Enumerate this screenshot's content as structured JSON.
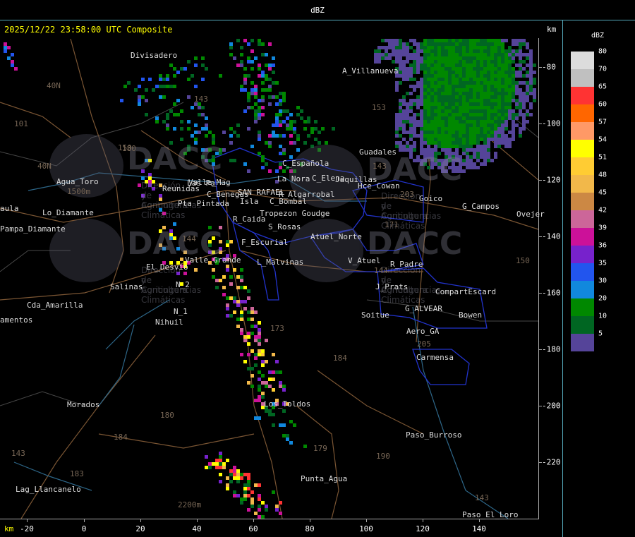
{
  "header": {
    "title": "dBZ"
  },
  "timestamp": "2025/12/22 23:58:00 UTC Composite",
  "units": {
    "km_top": "km",
    "km_bottom": "km"
  },
  "x_ticks": [
    "-20",
    "0",
    "20",
    "40",
    "60",
    "80",
    "100",
    "120",
    "140"
  ],
  "y_ticks": [
    "-80",
    "-100",
    "-120",
    "-140",
    "-160",
    "-180",
    "-200",
    "-220"
  ],
  "legend": {
    "title": "dBZ",
    "items": [
      {
        "label": "80",
        "color": "#dcdcdc"
      },
      {
        "label": "70",
        "color": "#c0c0c0"
      },
      {
        "label": "65",
        "color": "#ff3333"
      },
      {
        "label": "60",
        "color": "#ff6600"
      },
      {
        "label": "57",
        "color": "#ff9966"
      },
      {
        "label": "54",
        "color": "#ffff00"
      },
      {
        "label": "51",
        "color": "#ffcc33"
      },
      {
        "label": "48",
        "color": "#f2b84a"
      },
      {
        "label": "45",
        "color": "#cc8844"
      },
      {
        "label": "42",
        "color": "#cc6699"
      },
      {
        "label": "39",
        "color": "#cc1199"
      },
      {
        "label": "36",
        "color": "#7722cc"
      },
      {
        "label": "35",
        "color": "#2255ee"
      },
      {
        "label": "30",
        "color": "#1188dd"
      },
      {
        "label": "20",
        "color": "#008800"
      },
      {
        "label": "10",
        "color": "#006622"
      },
      {
        "label": "5",
        "color": "#554499"
      }
    ]
  },
  "towns": [
    {
      "name": "Divisadero"
    },
    {
      "name": "A_Villanueva"
    },
    {
      "name": "Guadales"
    },
    {
      "name": "Agua_Toro"
    },
    {
      "name": "Reunidas"
    },
    {
      "name": "Las Pa"
    },
    {
      "name": "C_Benegas"
    },
    {
      "name": "SAN RAFAEL"
    },
    {
      "name": "La Nora"
    },
    {
      "name": "C_Española"
    },
    {
      "name": "C_Elena"
    },
    {
      "name": "Jaquillas"
    },
    {
      "name": "Pta Pintada"
    },
    {
      "name": "Isla"
    },
    {
      "name": "R_Algarrobal"
    },
    {
      "name": "C_Bombal"
    },
    {
      "name": "Tropezon Goudge"
    },
    {
      "name": "Hce_Cowan"
    },
    {
      "name": "Goico"
    },
    {
      "name": "G_Campos"
    },
    {
      "name": "Ovejer"
    },
    {
      "name": "R_Caida"
    },
    {
      "name": "S_Rosas"
    },
    {
      "name": "Atuel_Norte"
    },
    {
      "name": "F_Escurial"
    },
    {
      "name": "Valle_Grande"
    },
    {
      "name": "L_Malvinas"
    },
    {
      "name": "V_Atuel"
    },
    {
      "name": "R_Padre"
    },
    {
      "name": "El_Desvio"
    },
    {
      "name": "Salinas"
    },
    {
      "name": "N_2"
    },
    {
      "name": "N_1"
    },
    {
      "name": "Nihuil"
    },
    {
      "name": "J_Prats"
    },
    {
      "name": "CompartEscard"
    },
    {
      "name": "G_ALVEAR"
    },
    {
      "name": "Soitue"
    },
    {
      "name": "Bowen"
    },
    {
      "name": "Aero_GA"
    },
    {
      "name": "Carmensa"
    },
    {
      "name": "Cda_Amarilla"
    },
    {
      "name": "amentos"
    },
    {
      "name": "aula"
    },
    {
      "name": "Pampa_Diamante"
    },
    {
      "name": "Lo_Diamante"
    },
    {
      "name": "Morados"
    },
    {
      "name": "Los_Toldos"
    },
    {
      "name": "Paso_Burroso"
    },
    {
      "name": "Punta_Agua"
    },
    {
      "name": "Lag_Llancanelo"
    },
    {
      "name": "Paso_El_Loro"
    },
    {
      "name": "Valle_Mag"
    }
  ],
  "route_labels": [
    "101",
    "40N",
    "150",
    "40N",
    "143",
    "144",
    "153",
    "143",
    "203",
    "171",
    "144",
    "173",
    "184",
    "179",
    "180",
    "190",
    "183",
    "184",
    "143",
    "205",
    "150",
    "180",
    "143"
  ],
  "elevations": [
    "1500m",
    "2200m"
  ],
  "watermark": {
    "logo_text": "DACC",
    "line1": "Dirección de Agricultura",
    "line2": "y Contingencias Climáticas"
  }
}
